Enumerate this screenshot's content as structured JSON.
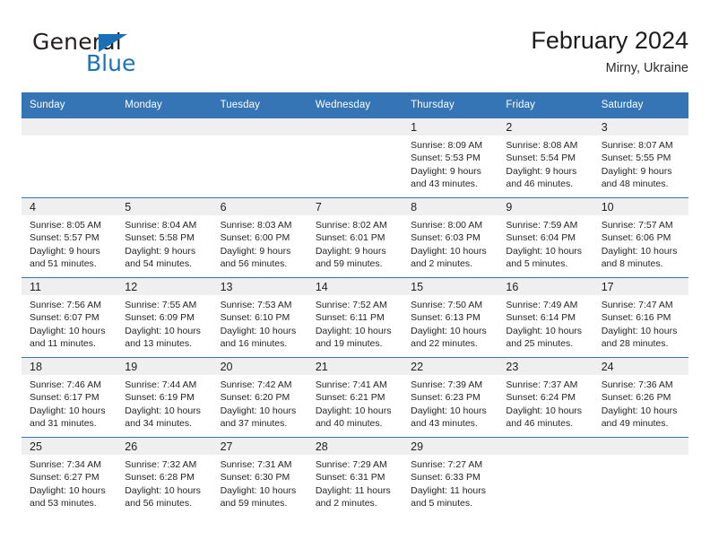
{
  "logo": {
    "word_one": "General",
    "word_two": "Blue",
    "triangle_color": "#1a6fb5",
    "word_two_color": "#1a72b8"
  },
  "header": {
    "title": "February 2024",
    "subtitle": "Mirny, Ukraine"
  },
  "theme": {
    "header_blue": "#3575b6",
    "daynum_band": "#efefef",
    "text": "#242424"
  },
  "calendar": {
    "weekday_headers": [
      "Sunday",
      "Monday",
      "Tuesday",
      "Wednesday",
      "Thursday",
      "Friday",
      "Saturday"
    ],
    "weeks": [
      [
        {
          "day": "",
          "empty": true
        },
        {
          "day": "",
          "empty": true
        },
        {
          "day": "",
          "empty": true
        },
        {
          "day": "",
          "empty": true
        },
        {
          "day": "1",
          "sunrise": "Sunrise: 8:09 AM",
          "sunset": "Sunset: 5:53 PM",
          "daylight_1": "Daylight: 9 hours",
          "daylight_2": "and 43 minutes."
        },
        {
          "day": "2",
          "sunrise": "Sunrise: 8:08 AM",
          "sunset": "Sunset: 5:54 PM",
          "daylight_1": "Daylight: 9 hours",
          "daylight_2": "and 46 minutes."
        },
        {
          "day": "3",
          "sunrise": "Sunrise: 8:07 AM",
          "sunset": "Sunset: 5:55 PM",
          "daylight_1": "Daylight: 9 hours",
          "daylight_2": "and 48 minutes."
        }
      ],
      [
        {
          "day": "4",
          "sunrise": "Sunrise: 8:05 AM",
          "sunset": "Sunset: 5:57 PM",
          "daylight_1": "Daylight: 9 hours",
          "daylight_2": "and 51 minutes."
        },
        {
          "day": "5",
          "sunrise": "Sunrise: 8:04 AM",
          "sunset": "Sunset: 5:58 PM",
          "daylight_1": "Daylight: 9 hours",
          "daylight_2": "and 54 minutes."
        },
        {
          "day": "6",
          "sunrise": "Sunrise: 8:03 AM",
          "sunset": "Sunset: 6:00 PM",
          "daylight_1": "Daylight: 9 hours",
          "daylight_2": "and 56 minutes."
        },
        {
          "day": "7",
          "sunrise": "Sunrise: 8:02 AM",
          "sunset": "Sunset: 6:01 PM",
          "daylight_1": "Daylight: 9 hours",
          "daylight_2": "and 59 minutes."
        },
        {
          "day": "8",
          "sunrise": "Sunrise: 8:00 AM",
          "sunset": "Sunset: 6:03 PM",
          "daylight_1": "Daylight: 10 hours",
          "daylight_2": "and 2 minutes."
        },
        {
          "day": "9",
          "sunrise": "Sunrise: 7:59 AM",
          "sunset": "Sunset: 6:04 PM",
          "daylight_1": "Daylight: 10 hours",
          "daylight_2": "and 5 minutes."
        },
        {
          "day": "10",
          "sunrise": "Sunrise: 7:57 AM",
          "sunset": "Sunset: 6:06 PM",
          "daylight_1": "Daylight: 10 hours",
          "daylight_2": "and 8 minutes."
        }
      ],
      [
        {
          "day": "11",
          "sunrise": "Sunrise: 7:56 AM",
          "sunset": "Sunset: 6:07 PM",
          "daylight_1": "Daylight: 10 hours",
          "daylight_2": "and 11 minutes."
        },
        {
          "day": "12",
          "sunrise": "Sunrise: 7:55 AM",
          "sunset": "Sunset: 6:09 PM",
          "daylight_1": "Daylight: 10 hours",
          "daylight_2": "and 13 minutes."
        },
        {
          "day": "13",
          "sunrise": "Sunrise: 7:53 AM",
          "sunset": "Sunset: 6:10 PM",
          "daylight_1": "Daylight: 10 hours",
          "daylight_2": "and 16 minutes."
        },
        {
          "day": "14",
          "sunrise": "Sunrise: 7:52 AM",
          "sunset": "Sunset: 6:11 PM",
          "daylight_1": "Daylight: 10 hours",
          "daylight_2": "and 19 minutes."
        },
        {
          "day": "15",
          "sunrise": "Sunrise: 7:50 AM",
          "sunset": "Sunset: 6:13 PM",
          "daylight_1": "Daylight: 10 hours",
          "daylight_2": "and 22 minutes."
        },
        {
          "day": "16",
          "sunrise": "Sunrise: 7:49 AM",
          "sunset": "Sunset: 6:14 PM",
          "daylight_1": "Daylight: 10 hours",
          "daylight_2": "and 25 minutes."
        },
        {
          "day": "17",
          "sunrise": "Sunrise: 7:47 AM",
          "sunset": "Sunset: 6:16 PM",
          "daylight_1": "Daylight: 10 hours",
          "daylight_2": "and 28 minutes."
        }
      ],
      [
        {
          "day": "18",
          "sunrise": "Sunrise: 7:46 AM",
          "sunset": "Sunset: 6:17 PM",
          "daylight_1": "Daylight: 10 hours",
          "daylight_2": "and 31 minutes."
        },
        {
          "day": "19",
          "sunrise": "Sunrise: 7:44 AM",
          "sunset": "Sunset: 6:19 PM",
          "daylight_1": "Daylight: 10 hours",
          "daylight_2": "and 34 minutes."
        },
        {
          "day": "20",
          "sunrise": "Sunrise: 7:42 AM",
          "sunset": "Sunset: 6:20 PM",
          "daylight_1": "Daylight: 10 hours",
          "daylight_2": "and 37 minutes."
        },
        {
          "day": "21",
          "sunrise": "Sunrise: 7:41 AM",
          "sunset": "Sunset: 6:21 PM",
          "daylight_1": "Daylight: 10 hours",
          "daylight_2": "and 40 minutes."
        },
        {
          "day": "22",
          "sunrise": "Sunrise: 7:39 AM",
          "sunset": "Sunset: 6:23 PM",
          "daylight_1": "Daylight: 10 hours",
          "daylight_2": "and 43 minutes."
        },
        {
          "day": "23",
          "sunrise": "Sunrise: 7:37 AM",
          "sunset": "Sunset: 6:24 PM",
          "daylight_1": "Daylight: 10 hours",
          "daylight_2": "and 46 minutes."
        },
        {
          "day": "24",
          "sunrise": "Sunrise: 7:36 AM",
          "sunset": "Sunset: 6:26 PM",
          "daylight_1": "Daylight: 10 hours",
          "daylight_2": "and 49 minutes."
        }
      ],
      [
        {
          "day": "25",
          "sunrise": "Sunrise: 7:34 AM",
          "sunset": "Sunset: 6:27 PM",
          "daylight_1": "Daylight: 10 hours",
          "daylight_2": "and 53 minutes."
        },
        {
          "day": "26",
          "sunrise": "Sunrise: 7:32 AM",
          "sunset": "Sunset: 6:28 PM",
          "daylight_1": "Daylight: 10 hours",
          "daylight_2": "and 56 minutes."
        },
        {
          "day": "27",
          "sunrise": "Sunrise: 7:31 AM",
          "sunset": "Sunset: 6:30 PM",
          "daylight_1": "Daylight: 10 hours",
          "daylight_2": "and 59 minutes."
        },
        {
          "day": "28",
          "sunrise": "Sunrise: 7:29 AM",
          "sunset": "Sunset: 6:31 PM",
          "daylight_1": "Daylight: 11 hours",
          "daylight_2": "and 2 minutes."
        },
        {
          "day": "29",
          "sunrise": "Sunrise: 7:27 AM",
          "sunset": "Sunset: 6:33 PM",
          "daylight_1": "Daylight: 11 hours",
          "daylight_2": "and 5 minutes."
        },
        {
          "day": "",
          "empty": true
        },
        {
          "day": "",
          "empty": true
        }
      ]
    ]
  }
}
